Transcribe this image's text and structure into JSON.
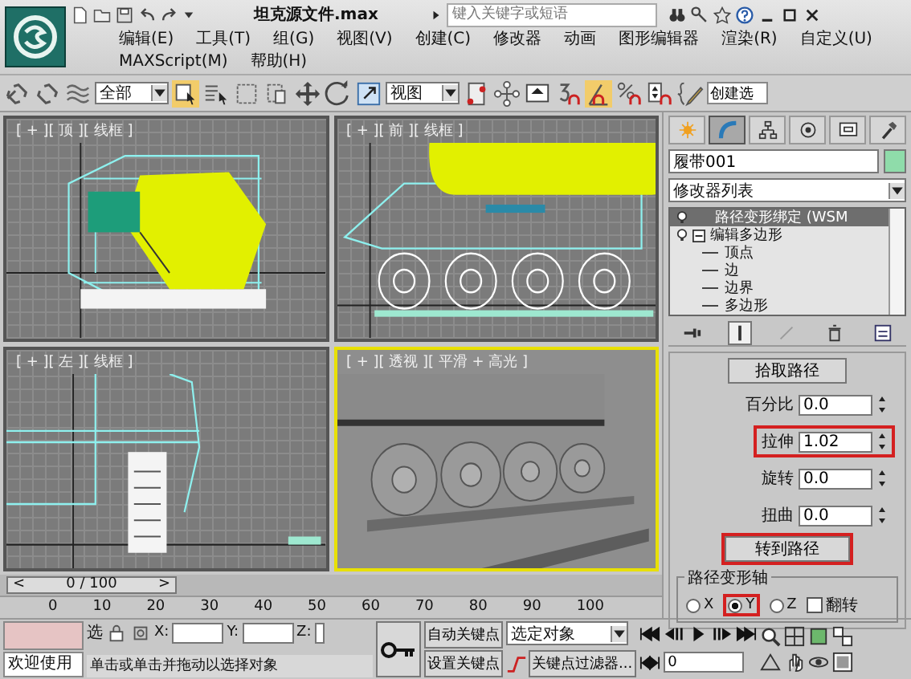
{
  "window": {
    "title": "坦克源文件.max",
    "search_placeholder": "键入关键字或短语"
  },
  "menu": [
    "编辑(E)",
    "工具(T)",
    "组(G)",
    "视图(V)",
    "创建(C)",
    "修改器",
    "动画",
    "图形编辑器",
    "渲染(R)",
    "自定义(U)",
    "MAXScript(M)",
    "帮助(H)"
  ],
  "toolbar": {
    "selection_filter": "全部",
    "reference_coord": "视图",
    "named_selection": "创建选"
  },
  "viewports": [
    {
      "kind": "top",
      "label": "[ + ][ 顶 ][ 线框 ]",
      "selected": false
    },
    {
      "kind": "front",
      "label": "[ + ][ 前 ][ 线框 ]",
      "selected": false
    },
    {
      "kind": "left",
      "label": "[ + ][ 左 ][ 线框 ]",
      "selected": false
    },
    {
      "kind": "perspective",
      "label": "[ + ][ 透视 ][ 平滑 + 高光 ]",
      "selected": true
    }
  ],
  "time_slider": {
    "prev": "<",
    "label": "0 / 100",
    "next": ">"
  },
  "ruler": [
    "0",
    "10",
    "20",
    "30",
    "40",
    "50",
    "60",
    "70",
    "80",
    "90",
    "100"
  ],
  "command_panel": {
    "tabs": [
      {
        "kind": "create",
        "selected": false
      },
      {
        "kind": "modify",
        "selected": true
      },
      {
        "kind": "hierarchy",
        "selected": false
      },
      {
        "kind": "motion",
        "selected": false
      },
      {
        "kind": "display",
        "selected": false
      },
      {
        "kind": "utilities",
        "selected": false
      }
    ],
    "object_name": "履带001",
    "modifier_list": "修改器列表",
    "stack": [
      {
        "label": "路径变形绑定 (WSM",
        "selected": true
      },
      {
        "label": "编辑多边形",
        "selected": false,
        "expanded": true,
        "children": [
          {
            "label": "顶点"
          },
          {
            "label": "边"
          },
          {
            "label": "边界"
          },
          {
            "label": "多边形"
          }
        ]
      }
    ],
    "pick_path": "拾取路径",
    "spinners": [
      {
        "label": "百分比",
        "value": "0.0",
        "highlighted": false
      },
      {
        "label": "拉伸",
        "value": "1.02",
        "highlighted": true
      },
      {
        "label": "旋转",
        "value": "0.0",
        "highlighted": false
      },
      {
        "label": "扭曲",
        "value": "0.0",
        "highlighted": false
      }
    ],
    "go_to_path": {
      "label": "转到路径",
      "highlighted": true
    },
    "axis_group": {
      "title": "路径变形轴",
      "options": [
        {
          "label": "X",
          "selected": false,
          "highlighted": false
        },
        {
          "label": "Y",
          "selected": true,
          "highlighted": true
        },
        {
          "label": "Z",
          "selected": false,
          "highlighted": false
        }
      ],
      "flip": {
        "label": "翻转",
        "checked": false
      }
    }
  },
  "status": {
    "welcome": "欢迎使用",
    "selection_lock": "选",
    "coord_labels": [
      "X:",
      "Y:",
      "Z:"
    ],
    "prompt": "单击或单击并拖动以选择对象",
    "auto_key": "自动关键点",
    "set_key": "设置关键点",
    "key_mode": "选定对象",
    "key_filters": "关键点过滤器...",
    "frame": "0"
  }
}
